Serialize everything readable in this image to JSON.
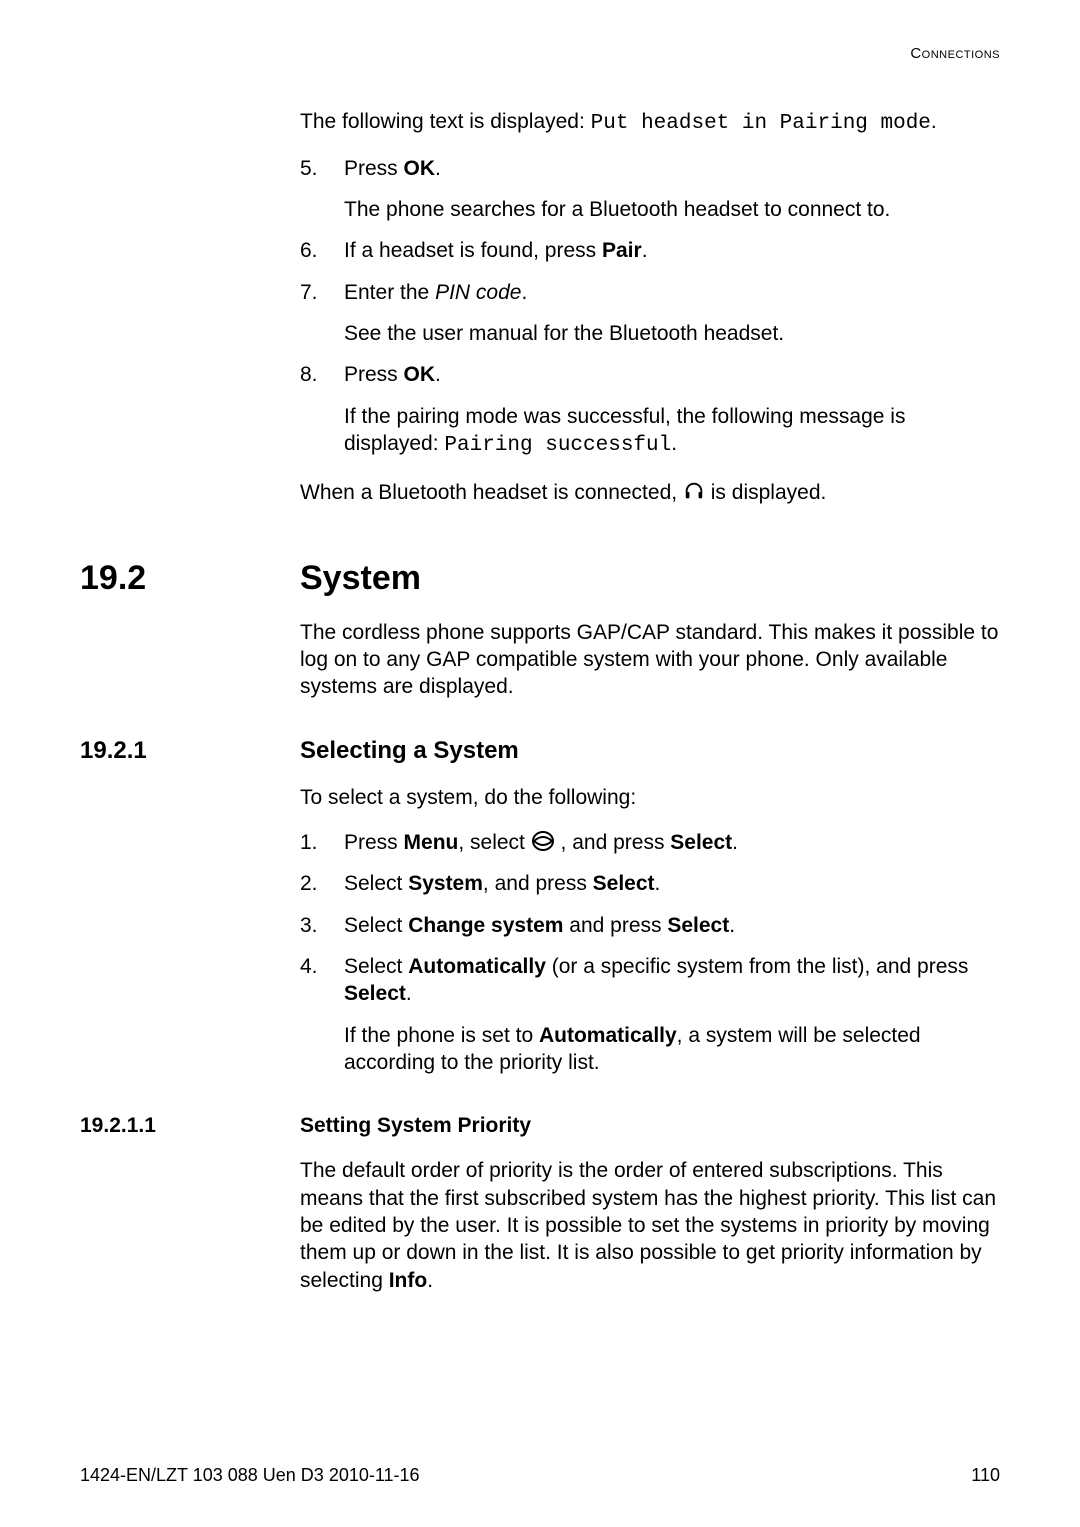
{
  "header": {
    "title": "Connections"
  },
  "intro": {
    "p1_prefix": "The following text is displayed: ",
    "p1_code": "Put headset in Pairing mode",
    "p1_suffix": "."
  },
  "steps_a": [
    {
      "num": "5.",
      "line1_prefix": "Press ",
      "line1_bold": "OK",
      "line1_suffix": ".",
      "line2": "The phone searches for a Bluetooth headset to connect to."
    },
    {
      "num": "6.",
      "line1_prefix": "If a headset is found, press ",
      "line1_bold": "Pair",
      "line1_suffix": "."
    },
    {
      "num": "7.",
      "line1_prefix": "Enter the ",
      "line1_italic": "PIN code",
      "line1_suffix": ".",
      "line2": "See the user manual for the Bluetooth headset."
    },
    {
      "num": "8.",
      "line1_prefix": "Press ",
      "line1_bold": "OK",
      "line1_suffix": ".",
      "line2_prefix": "If the pairing mode was successful, the following message is displayed: ",
      "line2_code": "Pairing successful",
      "line2_suffix": "."
    }
  ],
  "after_steps_a": {
    "prefix": "When a Bluetooth headset is connected, ",
    "suffix": " is displayed."
  },
  "sec_19_2": {
    "num": "19.2",
    "title": "System",
    "para": "The cordless phone supports GAP/CAP standard. This makes it possible to log on to any GAP compatible system with your phone. Only available systems are displayed."
  },
  "sec_19_2_1": {
    "num": "19.2.1",
    "title": "Selecting a System",
    "intro": "To select a system, do the following:"
  },
  "steps_b": [
    {
      "num": "1.",
      "pre": "Press ",
      "b1": "Menu",
      "mid1": ", select ",
      "mid2": " , and press ",
      "b2": "Select",
      "suf": "."
    },
    {
      "num": "2.",
      "pre": "Select ",
      "b1": "System",
      "mid1": ", and press ",
      "b2": "Select",
      "suf": "."
    },
    {
      "num": "3.",
      "pre": "Select ",
      "b1": "Change system",
      "mid1": " and press ",
      "b2": "Select",
      "suf": "."
    },
    {
      "num": "4.",
      "pre": "Select ",
      "b1": "Automatically",
      "mid1": " (or a specific system from the list), and press ",
      "b2": "Select",
      "suf": ".",
      "line2_pre": "If the phone is set to ",
      "line2_b": "Automatically",
      "line2_suf": ", a system will be selected according to the priority list."
    }
  ],
  "sec_19_2_1_1": {
    "num": "19.2.1.1",
    "title": "Setting System Priority",
    "para_pre": "The default order of priority is the order of entered subscriptions. This means that the first subscribed system has the highest priority. This list can be edited by the user. It is possible to set the systems in priority by moving them up or down in the list. It is also possible to get priority information by selecting ",
    "para_bold": "Info",
    "para_suf": "."
  },
  "footer": {
    "left": "1424-EN/LZT 103 088 Uen D3 2010-11-16",
    "right": "110"
  }
}
